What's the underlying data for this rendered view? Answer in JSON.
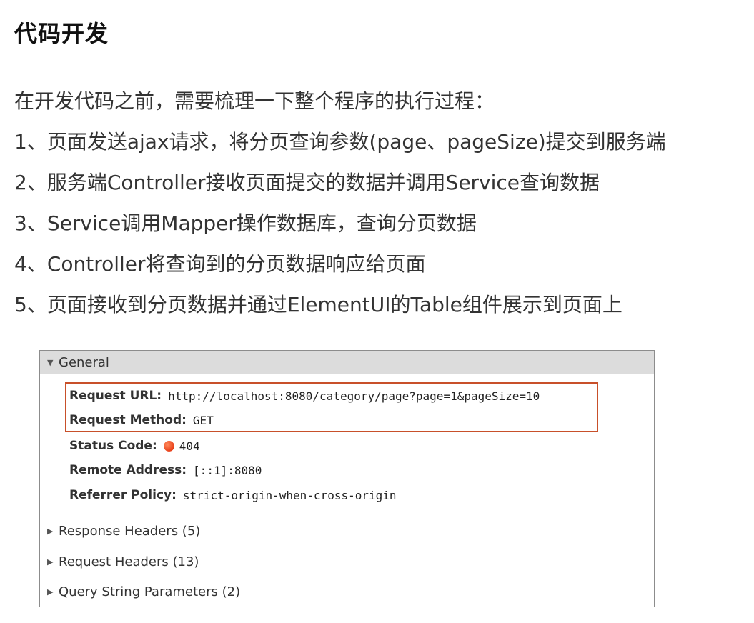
{
  "page": {
    "title": "代码开发",
    "lines": [
      "在开发代码之前，需要梳理一下整个程序的执行过程：",
      "1、页面发送ajax请求，将分页查询参数(page、pageSize)提交到服务端",
      "2、服务端Controller接收页面提交的数据并调用Service查询数据",
      "3、Service调用Mapper操作数据库，查询分页数据",
      "4、Controller将查询到的分页数据响应给页面",
      "5、页面接收到分页数据并通过ElementUI的Table组件展示到页面上"
    ]
  },
  "devtools": {
    "general": {
      "label": "General",
      "icon": "triangle-down-icon",
      "rows": [
        {
          "key": "Request URL:",
          "value": "http://localhost:8080/category/page?page=1&pageSize=10"
        },
        {
          "key": "Request Method:",
          "value": "GET"
        },
        {
          "key": "Status Code:",
          "value": "404",
          "status_color": "#e8401a"
        },
        {
          "key": "Remote Address:",
          "value": "[::1]:8080"
        },
        {
          "key": "Referrer Policy:",
          "value": "strict-origin-when-cross-origin"
        }
      ]
    },
    "sections": [
      {
        "label": "Response Headers (5)",
        "icon": "triangle-right-icon"
      },
      {
        "label": "Request Headers (13)",
        "icon": "triangle-right-icon"
      },
      {
        "label": "Query String Parameters (2)",
        "icon": "triangle-right-icon"
      }
    ],
    "highlight_color": "#c8502a"
  }
}
